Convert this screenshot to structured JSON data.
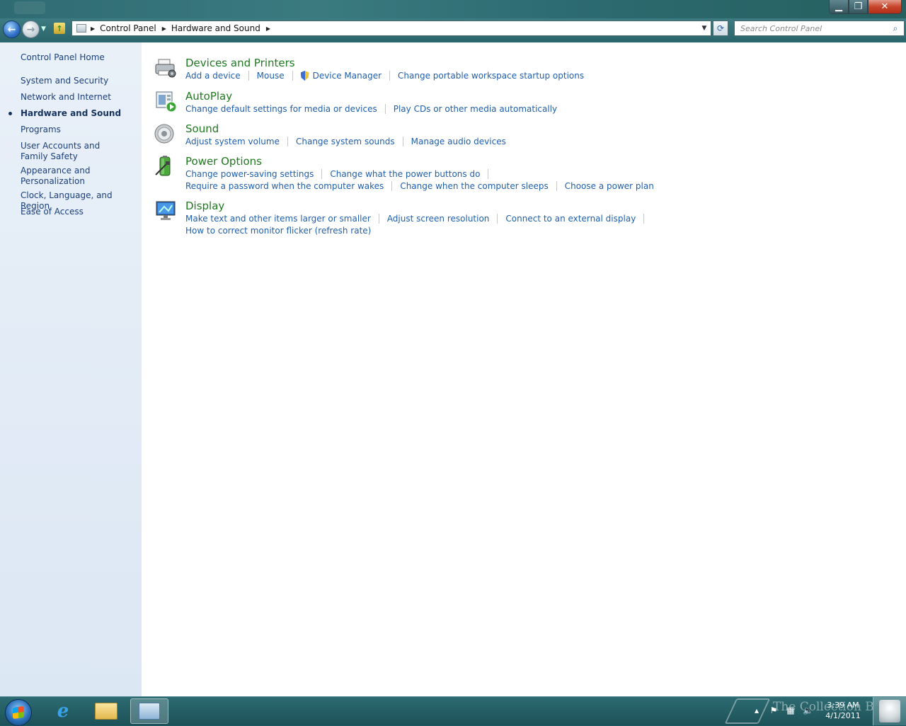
{
  "window": {
    "title": "",
    "controls": {
      "minimize": "▁",
      "maximize": "❐",
      "close": "✕"
    }
  },
  "navigation": {
    "breadcrumbs": [
      "Control Panel",
      "Hardware and Sound"
    ],
    "search_placeholder": "Search Control Panel"
  },
  "sidebar": {
    "home": "Control Panel Home",
    "items": [
      {
        "label": "System and Security"
      },
      {
        "label": "Network and Internet"
      },
      {
        "label": "Hardware and Sound",
        "active": true
      },
      {
        "label": "Programs"
      },
      {
        "label": "User Accounts and Family Safety"
      },
      {
        "label": "Appearance and Personalization"
      },
      {
        "label": "Clock, Language, and Region"
      },
      {
        "label": "Ease of Access"
      }
    ]
  },
  "categories": [
    {
      "title": "Devices and Printers",
      "icon": "printer-icon",
      "rows": [
        [
          "Add a device",
          "Mouse",
          "Device Manager",
          "Change portable workspace startup options"
        ]
      ]
    },
    {
      "title": "AutoPlay",
      "icon": "autoplay-icon",
      "rows": [
        [
          "Change default settings for media or devices",
          "Play CDs or other media automatically"
        ]
      ]
    },
    {
      "title": "Sound",
      "icon": "speaker-icon",
      "rows": [
        [
          "Adjust system volume",
          "Change system sounds",
          "Manage audio devices"
        ]
      ]
    },
    {
      "title": "Power Options",
      "icon": "battery-icon",
      "rows": [
        [
          "Change power-saving settings",
          "Change what the power buttons do"
        ],
        [
          "Require a password when the computer wakes",
          "Change when the computer sleeps",
          "Choose a power plan"
        ]
      ]
    },
    {
      "title": "Display",
      "icon": "monitor-icon",
      "rows": [
        [
          "Make text and other items larger or smaller",
          "Adjust screen resolution",
          "Connect to an external display"
        ],
        [
          "How to correct monitor flicker (refresh rate)"
        ]
      ]
    }
  ],
  "taskbar": {
    "apps": [
      {
        "name": "internet-explorer",
        "icon": "ie-icon"
      },
      {
        "name": "windows-explorer",
        "icon": "folder-icon"
      },
      {
        "name": "control-panel",
        "icon": "control-panel-icon",
        "active": true
      }
    ],
    "clock_time": "3:39 AM",
    "clock_date": "4/1/2011",
    "watermark": "The Collection Book"
  }
}
